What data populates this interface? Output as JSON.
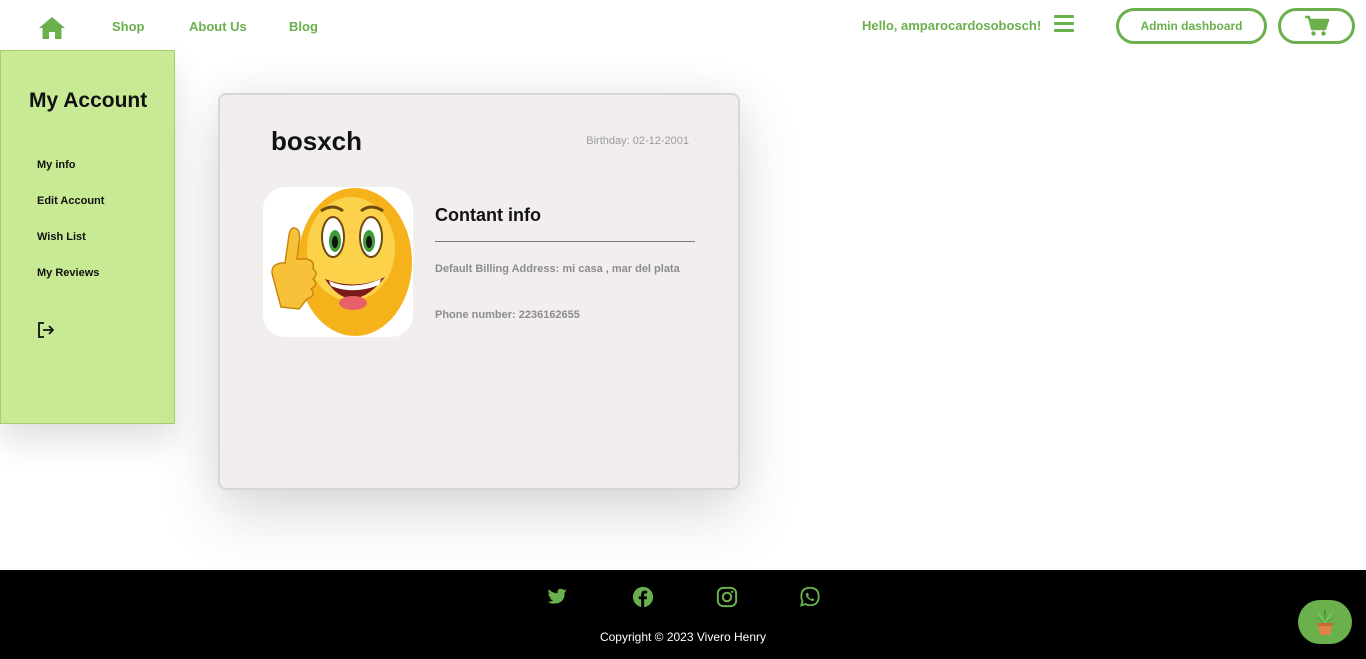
{
  "nav": {
    "home_icon": "home-icon",
    "links": [
      "Shop",
      "About Us",
      "Blog"
    ],
    "greeting": "Hello, amparocardosobosch!",
    "menu_icon": "hamburger-menu-icon",
    "admin_label": "Admin dashboard",
    "cart_icon": "cart-icon"
  },
  "sidebar": {
    "title": "My Account",
    "items": [
      "My info",
      "Edit Account",
      "Wish List",
      "My Reviews"
    ],
    "logout_icon": "logout-icon"
  },
  "profile": {
    "username": "bosxch",
    "birthday": "Birthday: 02-12-2001",
    "contact_title": "Contant info",
    "billing": "Default Billing Address: mi casa , mar del plata",
    "phone": "Phone number: 2236162655"
  },
  "footer": {
    "social_icons": [
      "twitter-icon",
      "facebook-icon",
      "instagram-icon",
      "whatsapp-icon"
    ],
    "copyright": "Copyright © 2023 Vivero Henry",
    "chat_icon": "plant-icon"
  },
  "colors": {
    "accent": "#6ab04c",
    "sidebar_bg": "#c9ea94",
    "card_bg": "#f1eeed",
    "footer_bg": "#000000"
  }
}
